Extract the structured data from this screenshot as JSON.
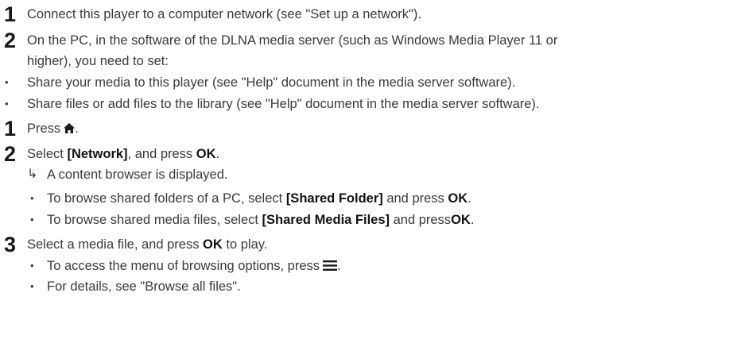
{
  "steps_a": {
    "s1": {
      "num": "1",
      "text": "Connect this player to a computer network (see \"Set up a network\")."
    },
    "s2": {
      "num": "2",
      "line1": "On the PC, in the software of the DLNA media server (such as Windows Media Player 11 or",
      "line2": "higher), you need to set:"
    },
    "bullets": [
      "Share your media to this player (see \"Help\" document in the media server software).",
      "Share files or add files to the library (see \"Help\" document in the media server software)."
    ]
  },
  "steps_b": {
    "s1": {
      "num": "1",
      "text": "Press",
      "icon": "home-icon",
      "after": "."
    },
    "s2": {
      "num": "2",
      "pre": "Select ",
      "kw1": "[Network]",
      "mid": ", and press ",
      "kw2": "OK",
      "post": ".",
      "result": "A content browser is displayed.",
      "bullets": [
        {
          "pre": "To browse shared folders of a PC, select ",
          "kw1": "[Shared Folder]",
          "mid": " and press ",
          "kw2": "OK",
          "post": "."
        },
        {
          "pre": "To browse shared media files, select ",
          "kw1": "[Shared Media Files]",
          "mid": " and press",
          "kw2": "OK",
          "post": "."
        }
      ]
    },
    "s3": {
      "num": "3",
      "pre": "Select a media file, and press ",
      "kw": "OK",
      "post": " to play.",
      "bullets": [
        {
          "text": "To access the menu of browsing options, press",
          "icon": "menu-icon",
          "after": "."
        },
        {
          "text": "For details, see \"Browse all files\"."
        }
      ]
    }
  },
  "glyphs": {
    "bullet": "•",
    "arrow": "↳"
  }
}
